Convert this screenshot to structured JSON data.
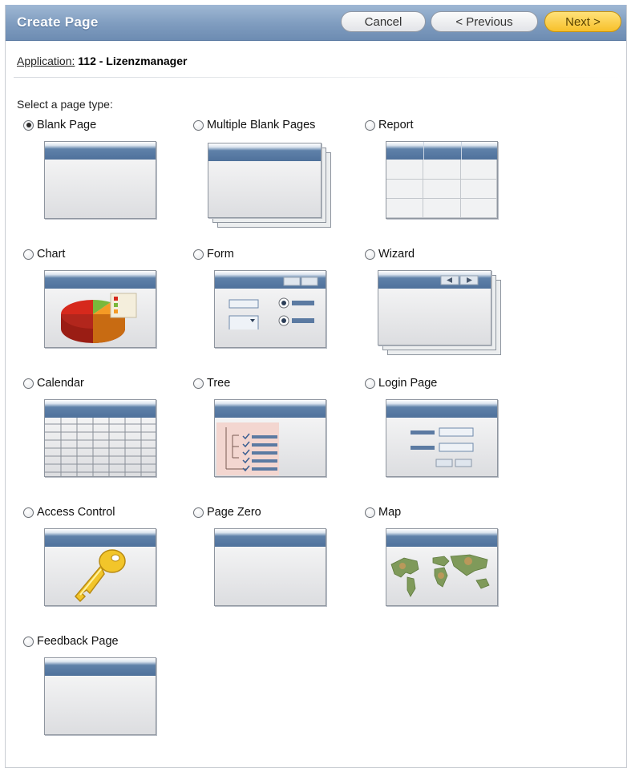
{
  "header": {
    "title": "Create Page",
    "cancel_label": "Cancel",
    "previous_label": "< Previous",
    "next_label": "Next >"
  },
  "application": {
    "label": "Application:",
    "value": "112 - Lizenzmanager"
  },
  "prompt": "Select a page type:",
  "options": [
    {
      "label": "Blank Page",
      "checked": true,
      "icon": "blank-page-icon"
    },
    {
      "label": "Multiple Blank Pages",
      "checked": false,
      "icon": "multiple-blank-pages-icon"
    },
    {
      "label": "Report",
      "checked": false,
      "icon": "report-icon"
    },
    {
      "label": "Chart",
      "checked": false,
      "icon": "chart-icon"
    },
    {
      "label": "Form",
      "checked": false,
      "icon": "form-icon"
    },
    {
      "label": "Wizard",
      "checked": false,
      "icon": "wizard-icon"
    },
    {
      "label": "Calendar",
      "checked": false,
      "icon": "calendar-icon"
    },
    {
      "label": "Tree",
      "checked": false,
      "icon": "tree-icon"
    },
    {
      "label": "Login Page",
      "checked": false,
      "icon": "login-page-icon"
    },
    {
      "label": "Access Control",
      "checked": false,
      "icon": "access-control-icon"
    },
    {
      "label": "Page Zero",
      "checked": false,
      "icon": "page-zero-icon"
    },
    {
      "label": "Map",
      "checked": false,
      "icon": "map-icon"
    },
    {
      "label": "Feedback Page",
      "checked": false,
      "icon": "feedback-page-icon"
    }
  ],
  "colors": {
    "header_blue": "#7f9cbf",
    "next_button": "#f7c02a",
    "thumb_bar": "#4f719b"
  }
}
